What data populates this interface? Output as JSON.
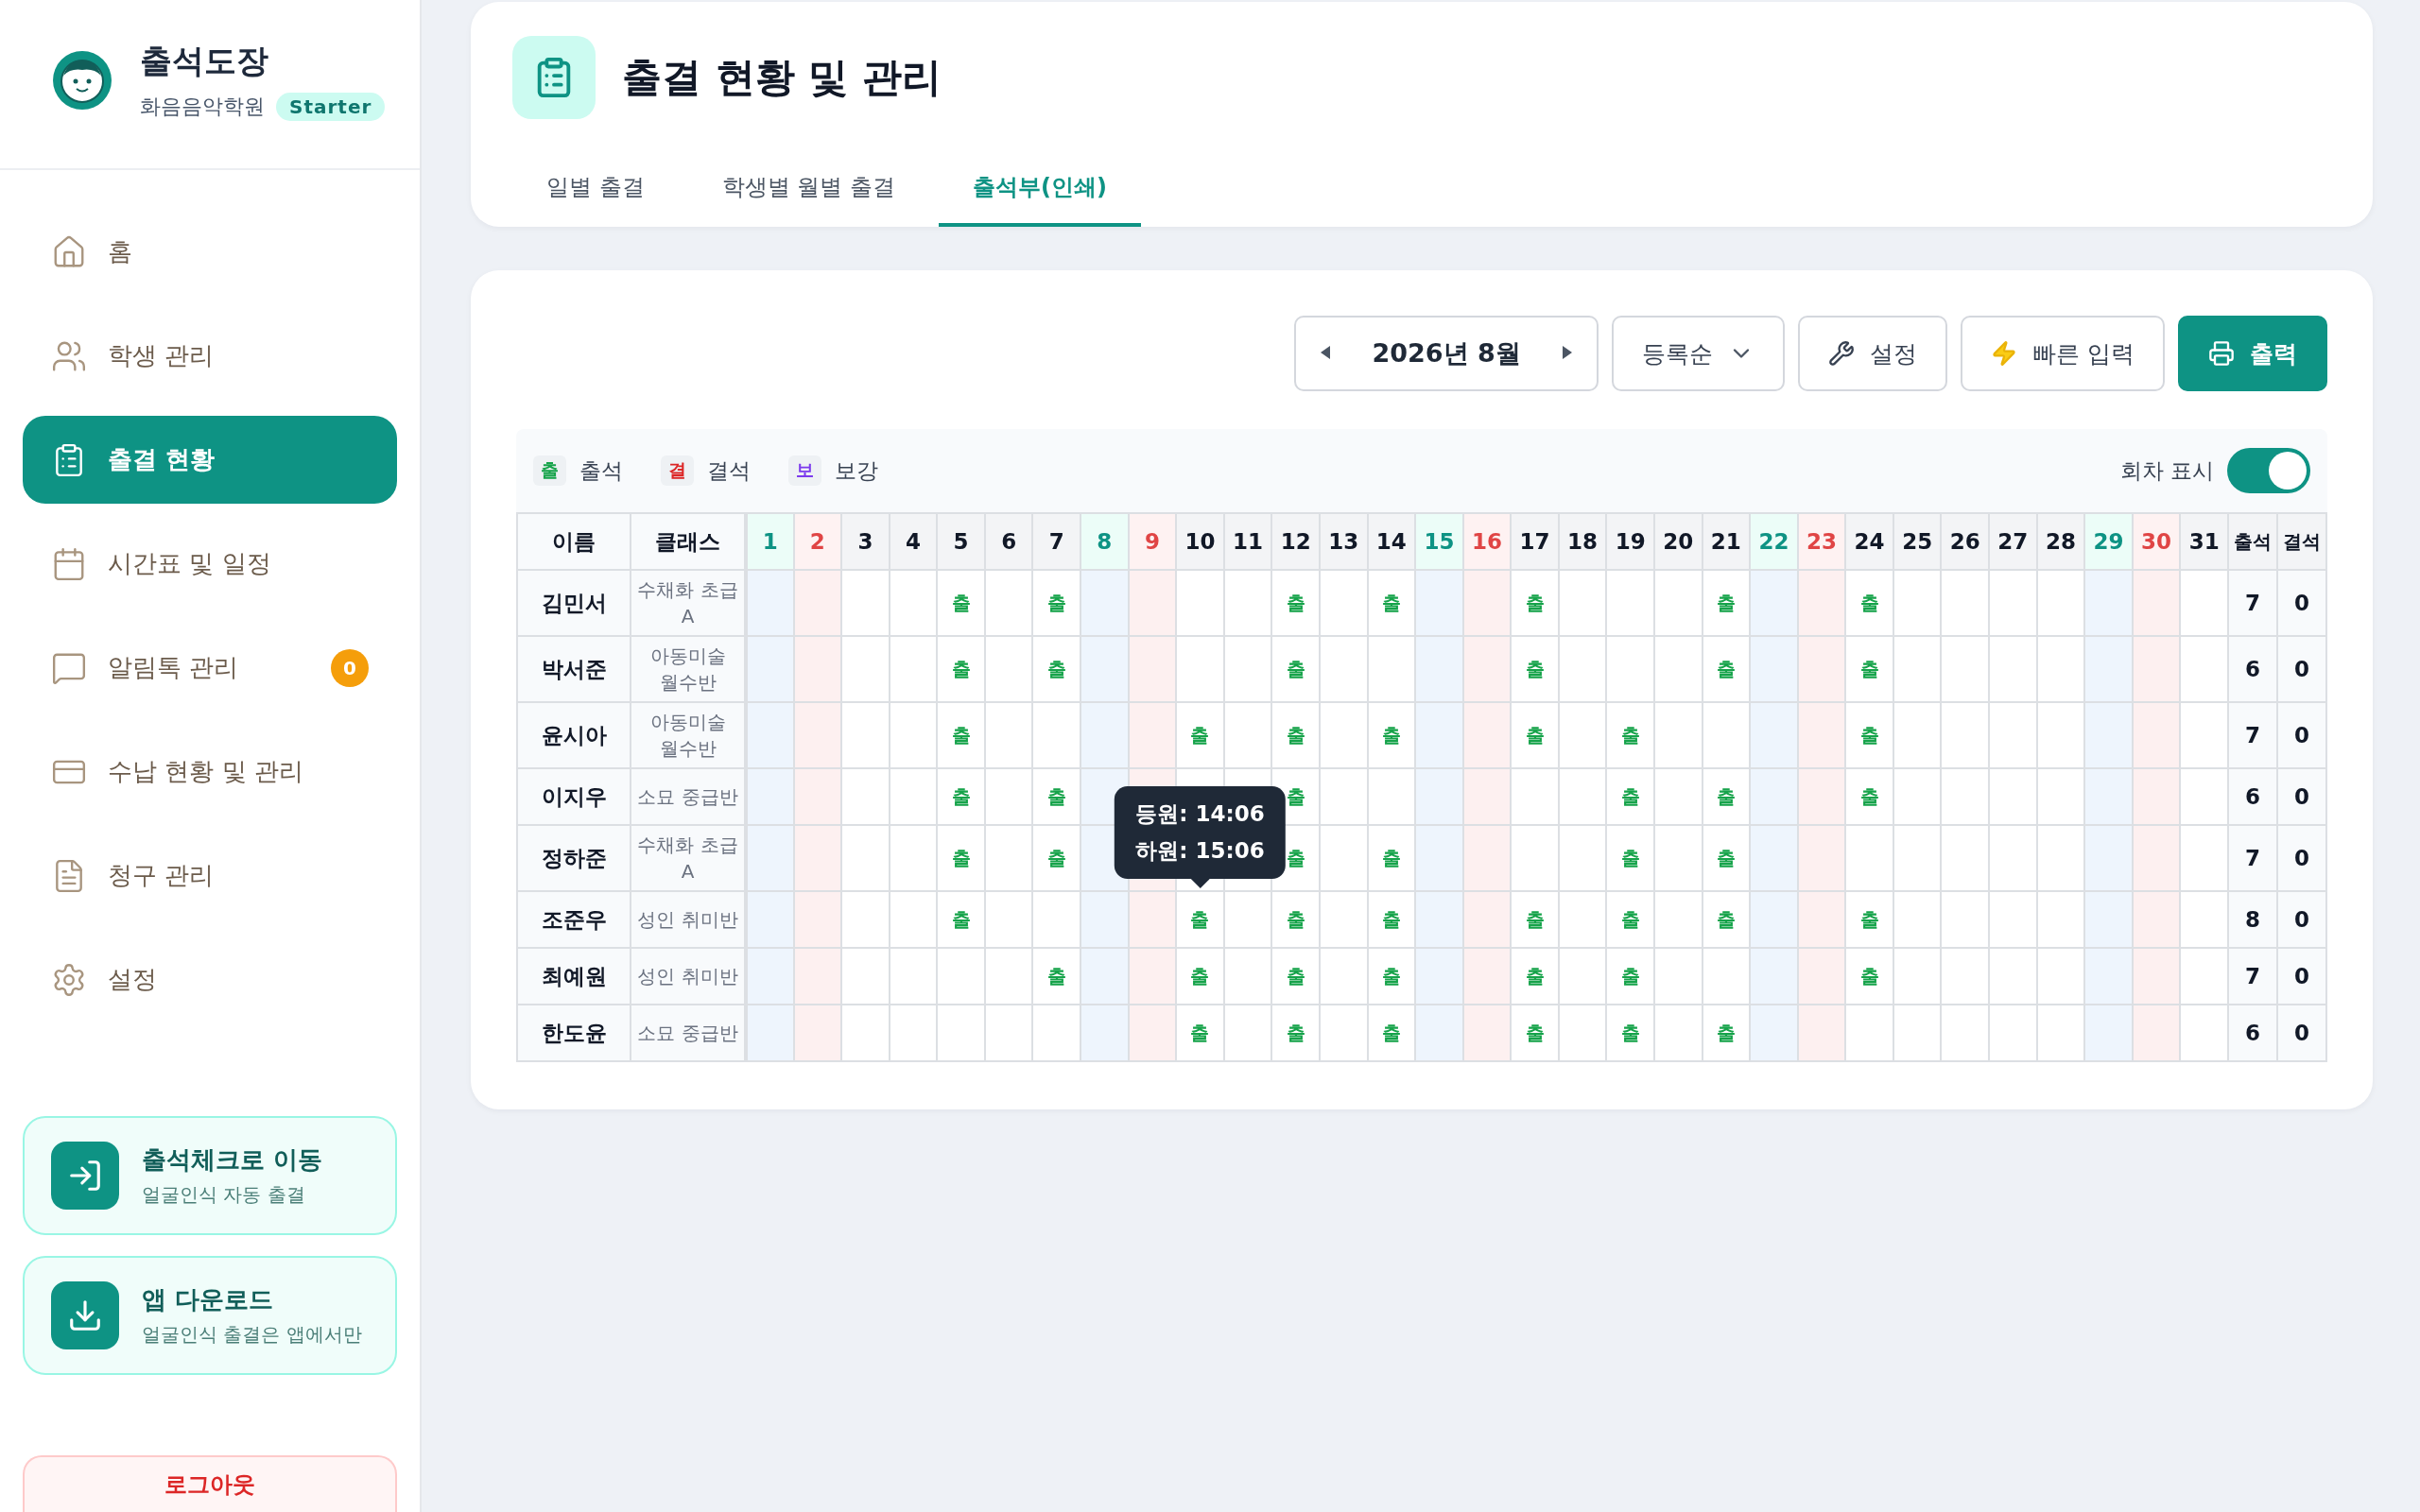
{
  "sidebar": {
    "brand": {
      "title": "출석도장",
      "subtitle": "화음음악학원",
      "plan": "Starter"
    },
    "nav": [
      {
        "label": "홈",
        "selected": false
      },
      {
        "label": "학생 관리",
        "selected": false
      },
      {
        "label": "출결 현황",
        "selected": true
      },
      {
        "label": "시간표 및 일정",
        "selected": false
      },
      {
        "label": "알림톡 관리",
        "selected": false,
        "badge": "0"
      },
      {
        "label": "수납 현황 및 관리",
        "selected": false
      },
      {
        "label": "청구 관리",
        "selected": false
      },
      {
        "label": "설정",
        "selected": false
      }
    ],
    "promos": [
      {
        "title": "출석체크로 이동",
        "subtitle": "얼굴인식 자동 출결",
        "kind": "enter"
      },
      {
        "title": "앱 다운로드",
        "subtitle": "얼굴인식 출결은 앱에서만",
        "kind": "download"
      }
    ],
    "logout": "로그아웃"
  },
  "header": {
    "title": "출결 현황 및 관리",
    "tabs": [
      {
        "label": "일별 출결",
        "selected": false
      },
      {
        "label": "학생별 월별 출결",
        "selected": false
      },
      {
        "label": "출석부(인쇄)",
        "selected": true
      }
    ]
  },
  "toolbar": {
    "month": "2026년 8월",
    "sort": "등록순",
    "buttons": [
      {
        "label": "설정",
        "kind": "tools"
      },
      {
        "label": "빠른 입력",
        "kind": "quick"
      },
      {
        "label": "출력",
        "kind": "print"
      }
    ]
  },
  "legend": [
    {
      "badge": "출",
      "label": "출석",
      "kind": "present"
    },
    {
      "badge": "결",
      "label": "결석",
      "kind": "absent"
    },
    {
      "badge": "보",
      "label": "보강",
      "kind": "makeup"
    }
  ],
  "round_toggle": {
    "label": "회차 표시",
    "on": true
  },
  "table": {
    "name_header": "이름",
    "class_header": "클래스",
    "total_headers": [
      "출석",
      "결석"
    ],
    "days": [
      {
        "label": "1",
        "kind": "sat"
      },
      {
        "label": "2",
        "kind": "sun"
      },
      {
        "label": "3",
        "kind": "weekday"
      },
      {
        "label": "4",
        "kind": "weekday"
      },
      {
        "label": "5",
        "kind": "weekday"
      },
      {
        "label": "6",
        "kind": "weekday"
      },
      {
        "label": "7",
        "kind": "weekday"
      },
      {
        "label": "8",
        "kind": "sat"
      },
      {
        "label": "9",
        "kind": "sun"
      },
      {
        "label": "10",
        "kind": "weekday"
      },
      {
        "label": "11",
        "kind": "weekday"
      },
      {
        "label": "12",
        "kind": "weekday"
      },
      {
        "label": "13",
        "kind": "weekday"
      },
      {
        "label": "14",
        "kind": "weekday"
      },
      {
        "label": "15",
        "kind": "sat"
      },
      {
        "label": "16",
        "kind": "sun"
      },
      {
        "label": "17",
        "kind": "weekday"
      },
      {
        "label": "18",
        "kind": "weekday"
      },
      {
        "label": "19",
        "kind": "weekday"
      },
      {
        "label": "20",
        "kind": "weekday"
      },
      {
        "label": "21",
        "kind": "weekday"
      },
      {
        "label": "22",
        "kind": "sat"
      },
      {
        "label": "23",
        "kind": "sun"
      },
      {
        "label": "24",
        "kind": "weekday"
      },
      {
        "label": "25",
        "kind": "weekday"
      },
      {
        "label": "26",
        "kind": "weekday"
      },
      {
        "label": "27",
        "kind": "weekday"
      },
      {
        "label": "28",
        "kind": "weekday"
      },
      {
        "label": "29",
        "kind": "sat"
      },
      {
        "label": "30",
        "kind": "sun"
      },
      {
        "label": "31",
        "kind": "weekday"
      }
    ],
    "rows": [
      {
        "name": "김민서",
        "class": "수채화 초급 A",
        "present": "7",
        "absent": "0",
        "cells": [
          {
            "kind": "empty"
          },
          {
            "kind": "empty"
          },
          {
            "kind": "empty"
          },
          {
            "kind": "empty"
          },
          {
            "kind": "present",
            "text": "출"
          },
          {
            "kind": "empty"
          },
          {
            "kind": "present",
            "text": "출"
          },
          {
            "kind": "empty"
          },
          {
            "kind": "empty"
          },
          {
            "kind": "empty"
          },
          {
            "kind": "empty"
          },
          {
            "kind": "present",
            "text": "출"
          },
          {
            "kind": "empty"
          },
          {
            "kind": "present",
            "text": "출"
          },
          {
            "kind": "empty"
          },
          {
            "kind": "empty"
          },
          {
            "kind": "present",
            "text": "출"
          },
          {
            "kind": "empty"
          },
          {
            "kind": "empty"
          },
          {
            "kind": "empty"
          },
          {
            "kind": "present",
            "text": "출"
          },
          {
            "kind": "empty"
          },
          {
            "kind": "empty"
          },
          {
            "kind": "present",
            "text": "출"
          },
          {
            "kind": "empty"
          },
          {
            "kind": "empty"
          },
          {
            "kind": "empty"
          },
          {
            "kind": "empty"
          },
          {
            "kind": "empty"
          },
          {
            "kind": "empty"
          },
          {
            "kind": "empty"
          }
        ]
      },
      {
        "name": "박서준",
        "class": "아동미술 월수반",
        "present": "6",
        "absent": "0",
        "cells": [
          {
            "kind": "empty"
          },
          {
            "kind": "empty"
          },
          {
            "kind": "empty"
          },
          {
            "kind": "empty"
          },
          {
            "kind": "present",
            "text": "출"
          },
          {
            "kind": "empty"
          },
          {
            "kind": "present",
            "text": "출"
          },
          {
            "kind": "empty"
          },
          {
            "kind": "empty"
          },
          {
            "kind": "empty"
          },
          {
            "kind": "empty"
          },
          {
            "kind": "present",
            "text": "출"
          },
          {
            "kind": "empty"
          },
          {
            "kind": "empty"
          },
          {
            "kind": "empty"
          },
          {
            "kind": "empty"
          },
          {
            "kind": "present",
            "text": "출"
          },
          {
            "kind": "empty"
          },
          {
            "kind": "empty"
          },
          {
            "kind": "empty"
          },
          {
            "kind": "present",
            "text": "출"
          },
          {
            "kind": "empty"
          },
          {
            "kind": "empty"
          },
          {
            "kind": "present",
            "text": "출"
          },
          {
            "kind": "empty"
          },
          {
            "kind": "empty"
          },
          {
            "kind": "empty"
          },
          {
            "kind": "empty"
          },
          {
            "kind": "empty"
          },
          {
            "kind": "empty"
          },
          {
            "kind": "empty"
          }
        ]
      },
      {
        "name": "윤시아",
        "class": "아동미술 월수반",
        "present": "7",
        "absent": "0",
        "cells": [
          {
            "kind": "empty"
          },
          {
            "kind": "empty"
          },
          {
            "kind": "empty"
          },
          {
            "kind": "empty"
          },
          {
            "kind": "present",
            "text": "출"
          },
          {
            "kind": "empty"
          },
          {
            "kind": "empty"
          },
          {
            "kind": "empty"
          },
          {
            "kind": "empty"
          },
          {
            "kind": "present",
            "text": "출"
          },
          {
            "kind": "empty"
          },
          {
            "kind": "present",
            "text": "출"
          },
          {
            "kind": "empty"
          },
          {
            "kind": "present",
            "text": "출"
          },
          {
            "kind": "empty"
          },
          {
            "kind": "empty"
          },
          {
            "kind": "present",
            "text": "출"
          },
          {
            "kind": "empty"
          },
          {
            "kind": "present",
            "text": "출"
          },
          {
            "kind": "empty"
          },
          {
            "kind": "empty"
          },
          {
            "kind": "empty"
          },
          {
            "kind": "empty"
          },
          {
            "kind": "present",
            "text": "출"
          },
          {
            "kind": "empty"
          },
          {
            "kind": "empty"
          },
          {
            "kind": "empty"
          },
          {
            "kind": "empty"
          },
          {
            "kind": "empty"
          },
          {
            "kind": "empty"
          },
          {
            "kind": "empty"
          }
        ]
      },
      {
        "name": "이지우",
        "class": "소묘 중급반",
        "present": "6",
        "absent": "0",
        "cells": [
          {
            "kind": "empty"
          },
          {
            "kind": "empty"
          },
          {
            "kind": "empty"
          },
          {
            "kind": "empty"
          },
          {
            "kind": "present",
            "text": "출"
          },
          {
            "kind": "empty"
          },
          {
            "kind": "present",
            "text": "출"
          },
          {
            "kind": "empty"
          },
          {
            "kind": "empty"
          },
          {
            "kind": "empty"
          },
          {
            "kind": "empty"
          },
          {
            "kind": "present",
            "text": "출"
          },
          {
            "kind": "empty"
          },
          {
            "kind": "empty"
          },
          {
            "kind": "empty"
          },
          {
            "kind": "empty"
          },
          {
            "kind": "empty"
          },
          {
            "kind": "empty"
          },
          {
            "kind": "present",
            "text": "출"
          },
          {
            "kind": "empty"
          },
          {
            "kind": "present",
            "text": "출"
          },
          {
            "kind": "empty"
          },
          {
            "kind": "empty"
          },
          {
            "kind": "present",
            "text": "출"
          },
          {
            "kind": "empty"
          },
          {
            "kind": "empty"
          },
          {
            "kind": "empty"
          },
          {
            "kind": "empty"
          },
          {
            "kind": "empty"
          },
          {
            "kind": "empty"
          },
          {
            "kind": "empty"
          }
        ]
      },
      {
        "name": "정하준",
        "class": "수채화 초급 A",
        "present": "7",
        "absent": "0",
        "cells": [
          {
            "kind": "empty"
          },
          {
            "kind": "empty"
          },
          {
            "kind": "empty"
          },
          {
            "kind": "empty"
          },
          {
            "kind": "present",
            "text": "출"
          },
          {
            "kind": "empty"
          },
          {
            "kind": "present",
            "text": "출"
          },
          {
            "kind": "empty"
          },
          {
            "kind": "empty"
          },
          {
            "kind": "empty"
          },
          {
            "kind": "empty"
          },
          {
            "kind": "present",
            "text": "출"
          },
          {
            "kind": "empty"
          },
          {
            "kind": "present",
            "text": "출"
          },
          {
            "kind": "empty"
          },
          {
            "kind": "empty"
          },
          {
            "kind": "empty"
          },
          {
            "kind": "empty"
          },
          {
            "kind": "present",
            "text": "출"
          },
          {
            "kind": "empty"
          },
          {
            "kind": "present",
            "text": "출"
          },
          {
            "kind": "empty"
          },
          {
            "kind": "empty"
          },
          {
            "kind": "empty"
          },
          {
            "kind": "empty"
          },
          {
            "kind": "empty"
          },
          {
            "kind": "empty"
          },
          {
            "kind": "empty"
          },
          {
            "kind": "empty"
          },
          {
            "kind": "empty"
          },
          {
            "kind": "empty"
          }
        ]
      },
      {
        "name": "조준우",
        "class": "성인 취미반",
        "present": "8",
        "absent": "0",
        "cells": [
          {
            "kind": "empty"
          },
          {
            "kind": "empty"
          },
          {
            "kind": "empty"
          },
          {
            "kind": "empty"
          },
          {
            "kind": "present",
            "text": "출"
          },
          {
            "kind": "empty"
          },
          {
            "kind": "empty"
          },
          {
            "kind": "empty"
          },
          {
            "kind": "empty"
          },
          {
            "kind": "present",
            "text": "출",
            "tooltip": [
              "등원: 14:06",
              "하원: 15:06"
            ]
          },
          {
            "kind": "empty"
          },
          {
            "kind": "present",
            "text": "출"
          },
          {
            "kind": "empty"
          },
          {
            "kind": "present",
            "text": "출"
          },
          {
            "kind": "empty"
          },
          {
            "kind": "empty"
          },
          {
            "kind": "present",
            "text": "출"
          },
          {
            "kind": "empty"
          },
          {
            "kind": "present",
            "text": "출"
          },
          {
            "kind": "empty"
          },
          {
            "kind": "present",
            "text": "출"
          },
          {
            "kind": "empty"
          },
          {
            "kind": "empty"
          },
          {
            "kind": "present",
            "text": "출"
          },
          {
            "kind": "empty"
          },
          {
            "kind": "empty"
          },
          {
            "kind": "empty"
          },
          {
            "kind": "empty"
          },
          {
            "kind": "empty"
          },
          {
            "kind": "empty"
          },
          {
            "kind": "empty"
          }
        ]
      },
      {
        "name": "최예원",
        "class": "성인 취미반",
        "present": "7",
        "absent": "0",
        "cells": [
          {
            "kind": "empty"
          },
          {
            "kind": "empty"
          },
          {
            "kind": "empty"
          },
          {
            "kind": "empty"
          },
          {
            "kind": "empty"
          },
          {
            "kind": "empty"
          },
          {
            "kind": "present",
            "text": "출"
          },
          {
            "kind": "empty"
          },
          {
            "kind": "empty"
          },
          {
            "kind": "present",
            "text": "출"
          },
          {
            "kind": "empty"
          },
          {
            "kind": "present",
            "text": "출"
          },
          {
            "kind": "empty"
          },
          {
            "kind": "present",
            "text": "출"
          },
          {
            "kind": "empty"
          },
          {
            "kind": "empty"
          },
          {
            "kind": "present",
            "text": "출"
          },
          {
            "kind": "empty"
          },
          {
            "kind": "present",
            "text": "출"
          },
          {
            "kind": "empty"
          },
          {
            "kind": "empty"
          },
          {
            "kind": "empty"
          },
          {
            "kind": "empty"
          },
          {
            "kind": "present",
            "text": "출"
          },
          {
            "kind": "empty"
          },
          {
            "kind": "empty"
          },
          {
            "kind": "empty"
          },
          {
            "kind": "empty"
          },
          {
            "kind": "empty"
          },
          {
            "kind": "empty"
          },
          {
            "kind": "empty"
          }
        ]
      },
      {
        "name": "한도윤",
        "class": "소묘 중급반",
        "present": "6",
        "absent": "0",
        "cells": [
          {
            "kind": "empty"
          },
          {
            "kind": "empty"
          },
          {
            "kind": "empty"
          },
          {
            "kind": "empty"
          },
          {
            "kind": "empty"
          },
          {
            "kind": "empty"
          },
          {
            "kind": "empty"
          },
          {
            "kind": "empty"
          },
          {
            "kind": "empty"
          },
          {
            "kind": "present",
            "text": "출"
          },
          {
            "kind": "empty"
          },
          {
            "kind": "present",
            "text": "출"
          },
          {
            "kind": "empty"
          },
          {
            "kind": "present",
            "text": "출"
          },
          {
            "kind": "empty"
          },
          {
            "kind": "empty"
          },
          {
            "kind": "present",
            "text": "출"
          },
          {
            "kind": "empty"
          },
          {
            "kind": "present",
            "text": "출"
          },
          {
            "kind": "empty"
          },
          {
            "kind": "present",
            "text": "출"
          },
          {
            "kind": "empty"
          },
          {
            "kind": "empty"
          },
          {
            "kind": "empty"
          },
          {
            "kind": "empty"
          },
          {
            "kind": "empty"
          },
          {
            "kind": "empty"
          },
          {
            "kind": "empty"
          },
          {
            "kind": "empty"
          },
          {
            "kind": "empty"
          },
          {
            "kind": "empty"
          }
        ]
      }
    ]
  }
}
